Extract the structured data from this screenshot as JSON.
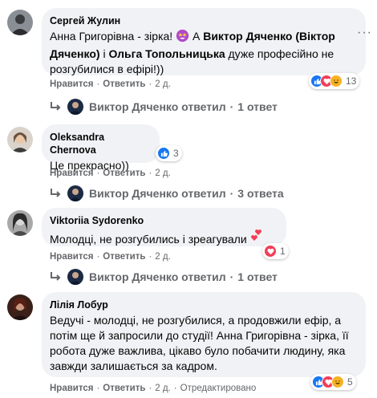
{
  "comments": [
    {
      "author": "Сергей Жулин",
      "text_parts": [
        "Анна Григорівна - зірка! ",
        " А ",
        "Виктор Дяченко (Віктор Дяченко)",
        " і ",
        "Ольга Топольницька",
        " дуже професійно не розгубилися в ефірі!))"
      ],
      "like_label": "Нравится",
      "reply_label": "Ответить",
      "time": "2 д.",
      "reaction_count": "13",
      "reply_summary": "Виктор Дяченко ответил",
      "reply_count": "1 ответ"
    },
    {
      "author": "Oleksandra Chernova",
      "text": "Це прекрасно))",
      "like_label": "Нравится",
      "reply_label": "Ответить",
      "time": "2 д.",
      "reaction_count": "3",
      "reply_summary": "Виктор Дяченко ответил",
      "reply_count": "3 ответа"
    },
    {
      "author": "Viktoriia Sydorenko",
      "text": "Молодці, не розгубились і зреагували",
      "like_label": "Нравится",
      "reply_label": "Ответить",
      "time": "2 д.",
      "reaction_count": "1",
      "reply_summary": "Виктор Дяченко ответил",
      "reply_count": "1 ответ"
    },
    {
      "author": "Лілія Лобур",
      "text": "Ведучі - молодці, не розгубилися, а продовжили ефір, а потім ще й запросили до студії! Анна Григорівна - зірка, її робота дуже важлива, цікаво було побачити людину, яка завжди залишається за кадром.",
      "like_label": "Нравится",
      "reply_label": "Ответить",
      "time": "2 д.",
      "edited_label": "Отредактировано",
      "reaction_count": "5"
    }
  ],
  "colors": {
    "bubble": "#f0f2f5",
    "muted": "#65676b",
    "like_blue": "#1877f2",
    "love_red": "#f33e58",
    "haha_yellow": "#f7b125"
  },
  "icons": [
    "like-icon",
    "love-icon",
    "haha-icon",
    "star-struck-emoji",
    "hearts-emoji",
    "reply-arrow-icon",
    "more-dots-icon"
  ]
}
